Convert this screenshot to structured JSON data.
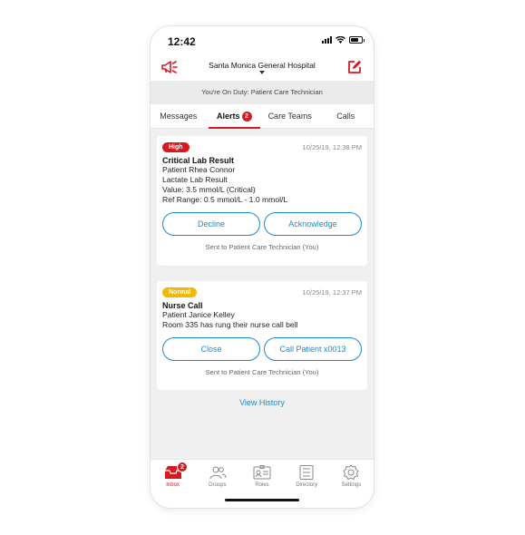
{
  "status_bar": {
    "time": "12:42"
  },
  "header": {
    "hospital": "Santa Monica General Hospital"
  },
  "duty_banner": "You're On Duty: Patient Care Technician",
  "tabs": [
    {
      "label": "Messages"
    },
    {
      "label": "Alerts",
      "badge": "2"
    },
    {
      "label": "Care Teams"
    },
    {
      "label": "Calls"
    }
  ],
  "alerts": [
    {
      "priority": "High",
      "timestamp": "10/25/19, 12:38 PM",
      "title": "Critical Lab Result",
      "lines": [
        "Patient Rhea Connor",
        "Lactate Lab Result",
        "Value: 3.5 mmol/L (Critical)",
        "Ref Range: 0.5 mmol/L - 1.0 mmol/L"
      ],
      "actions": [
        "Decline",
        "Acknowledge"
      ],
      "sent_to": "Sent to Patient Care Technician (You)"
    },
    {
      "priority": "Normal",
      "timestamp": "10/25/19, 12:37 PM",
      "title": "Nurse Call",
      "lines": [
        "Patient Janice Kelley",
        "Room 335 has rung their nurse call bell"
      ],
      "actions": [
        "Close",
        "Call Patient x0013"
      ],
      "sent_to": "Sent to Patient Care Technician (You)"
    }
  ],
  "view_history": "View History",
  "nav": [
    {
      "label": "Inbox",
      "badge": "2",
      "icon": "inbox-icon"
    },
    {
      "label": "Groups",
      "icon": "groups-icon"
    },
    {
      "label": "Roles",
      "icon": "roles-icon"
    },
    {
      "label": "Directory",
      "icon": "directory-icon"
    },
    {
      "label": "Settings",
      "icon": "settings-icon"
    }
  ],
  "colors": {
    "accent": "#d71920",
    "link": "#1a8dc9",
    "high": "#d71920",
    "normal": "#f2b705"
  }
}
